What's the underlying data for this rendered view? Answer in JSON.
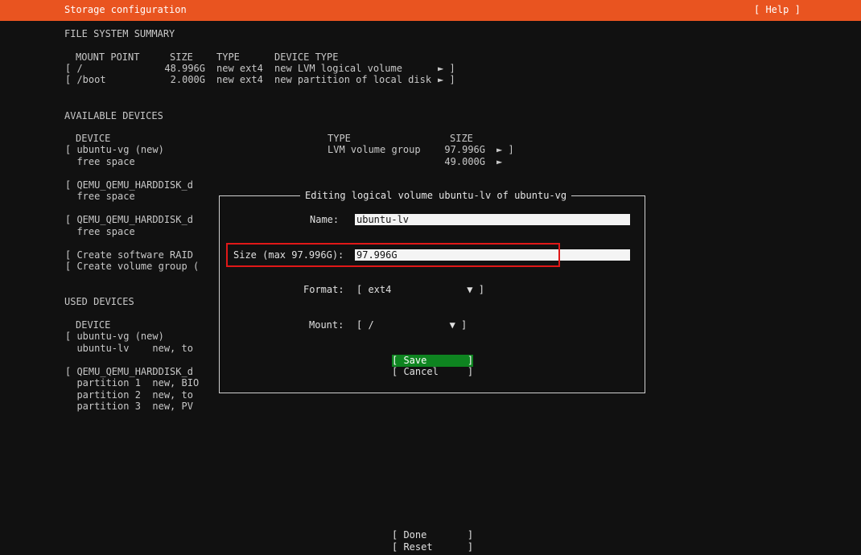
{
  "header": {
    "title": "Storage configuration",
    "help_label": "[ Help ]",
    "accent_color": "#e95420"
  },
  "fs_summary": {
    "title": "FILE SYSTEM SUMMARY",
    "headers": [
      "MOUNT POINT",
      "SIZE",
      "TYPE",
      "DEVICE TYPE"
    ],
    "rows": [
      {
        "mount": "[ /",
        "size": "48.996G",
        "type": "new ext4",
        "devtype": "new LVM logical volume",
        "arrow": "► ]"
      },
      {
        "mount": "[ /boot",
        "size": "2.000G",
        "type": "new ext4",
        "devtype": "new partition of local disk",
        "arrow": "► ]"
      }
    ]
  },
  "available": {
    "title": "AVAILABLE DEVICES",
    "headers": [
      "DEVICE",
      "TYPE",
      "SIZE"
    ],
    "rows": [
      {
        "device": "[ ubuntu-vg (new)",
        "type": "LVM volume group",
        "size": "97.996G",
        "arrow": "► ]"
      },
      {
        "device": "  free space",
        "type": "",
        "size": "49.000G",
        "arrow": "►"
      }
    ],
    "disk1": "[ QEMU_QEMU_HARDDISK_d",
    "disk1_sub": "  free space",
    "disk2": "[ QEMU_QEMU_HARDDISK_d",
    "disk2_sub": "  free space",
    "raid": "[ Create software RAID",
    "vg": "[ Create volume group ("
  },
  "used": {
    "title": "USED DEVICES",
    "header": "DEVICE",
    "vg": "[ ubuntu-vg (new)",
    "lv": "  ubuntu-lv    new, to",
    "disk": "[ QEMU_QEMU_HARDDISK_d",
    "p1": "  partition 1  new, BIO",
    "p2": "  partition 2  new, to",
    "p3": "  partition 3  new, PV"
  },
  "dialog": {
    "title": "Editing logical volume ubuntu-lv of ubuntu-vg",
    "name_label": "Name:",
    "name_value": "ubuntu-lv",
    "size_label": "Size (max 97.996G):",
    "size_value": "97.996G",
    "format_label": "Format:",
    "format_value": "[ ext4             ▼ ]",
    "mount_label": "Mount:",
    "mount_value": "[ /             ▼ ]",
    "save_label": "[ Save       ]",
    "cancel_label": "[ Cancel     ]"
  },
  "footer": {
    "done_label": "[ Done       ]",
    "reset_label": "[ Reset      ]"
  }
}
